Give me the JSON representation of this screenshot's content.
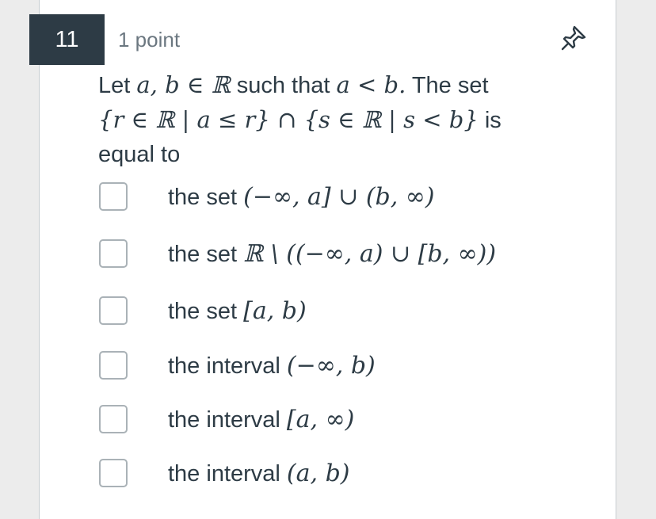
{
  "question": {
    "number": "11",
    "points": "1 point",
    "line1_text": "Let ",
    "line1_math1": "a, b ∈ ℝ",
    "line1_text2": " such that ",
    "line1_math2": "a < b.",
    "line1_text3": " The set",
    "line2_math": "{r ∈ ℝ | a ≤ r} ∩ {s ∈ ℝ | s < b}",
    "line2_text": " is",
    "line3_text": "equal to"
  },
  "choices": [
    {
      "prefix": "the set ",
      "math": "(−∞, a] ∪ (b, ∞)"
    },
    {
      "prefix": "the set ",
      "math": "ℝ \\ ((−∞, a) ∪ [b, ∞))"
    },
    {
      "prefix": "the set ",
      "math": "[a, b)"
    },
    {
      "prefix": "the interval ",
      "math": "(−∞, b)"
    },
    {
      "prefix": "the interval ",
      "math": "[a, ∞)"
    },
    {
      "prefix": "the interval ",
      "math": "(a, b)"
    }
  ],
  "icons": {
    "pin": "pushpin-icon"
  },
  "colors": {
    "number_badge_bg": "#2d3b45",
    "text": "#2d3b45",
    "muted": "#6b7780",
    "checkbox_border": "#aab2b7"
  }
}
